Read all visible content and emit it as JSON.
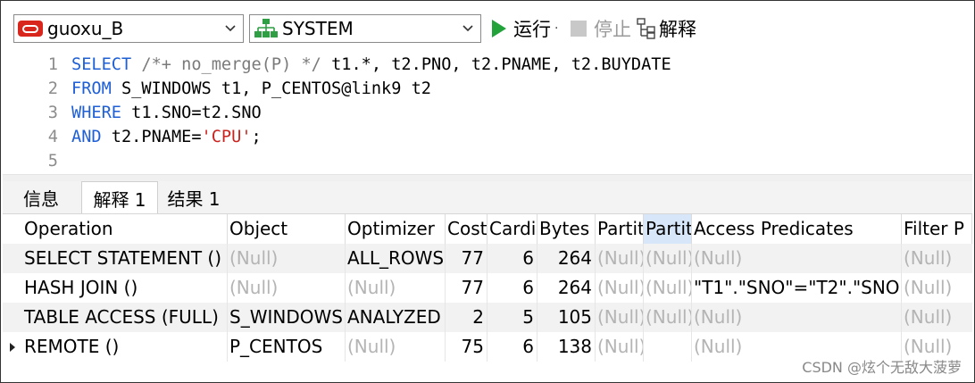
{
  "toolbar": {
    "connection": "guoxu_B",
    "schema": "SYSTEM",
    "run_label": "运行",
    "run_dropdown": "·",
    "stop_label": "停止",
    "explain_label": "解释"
  },
  "editor": {
    "lines": [
      {
        "num": "1",
        "parts": [
          {
            "t": "SELECT",
            "c": "kw"
          },
          {
            "t": " ",
            "c": ""
          },
          {
            "t": "/*+ no_merge(P) */",
            "c": "cm"
          },
          {
            "t": " t1.*, t2.PNO, t2.PNAME, t2.BUYDATE",
            "c": ""
          }
        ]
      },
      {
        "num": "2",
        "parts": [
          {
            "t": "FROM",
            "c": "kw"
          },
          {
            "t": " S_WINDOWS t1, P_CENTOS@link9 t2",
            "c": ""
          }
        ]
      },
      {
        "num": "3",
        "parts": [
          {
            "t": "WHERE",
            "c": "kw"
          },
          {
            "t": " t1.SNO=t2.SNO",
            "c": ""
          }
        ]
      },
      {
        "num": "4",
        "parts": [
          {
            "t": "AND",
            "c": "kw"
          },
          {
            "t": " t2.PNAME=",
            "c": ""
          },
          {
            "t": "'CPU'",
            "c": "str"
          },
          {
            "t": ";",
            "c": ""
          }
        ]
      },
      {
        "num": "5",
        "parts": []
      }
    ]
  },
  "tabs": [
    {
      "label": "信息",
      "active": false
    },
    {
      "label": "解释 1",
      "active": true
    },
    {
      "label": "结果 1",
      "active": false
    }
  ],
  "grid": {
    "columns": [
      "Operation",
      "Object",
      "Optimizer",
      "Cost",
      "Cardi",
      "Bytes",
      "Partit",
      "Partit",
      "Access Predicates",
      "Filter P"
    ],
    "rows": [
      {
        "cells": [
          "SELECT STATEMENT ()",
          "(Null)",
          "ALL_ROWS",
          "77",
          "6",
          "264",
          "(Null)",
          "(Null)",
          "(Null)",
          "(Null)"
        ],
        "current": false
      },
      {
        "cells": [
          " HASH JOIN ()",
          "(Null)",
          "(Null)",
          "77",
          "6",
          "264",
          "(Null)",
          "(Null)",
          "\"T1\".\"SNO\"=\"T2\".\"SNO\"",
          "(Null)"
        ],
        "current": false
      },
      {
        "cells": [
          "  TABLE ACCESS (FULL)",
          "S_WINDOWS",
          "ANALYZED",
          "2",
          "5",
          "105",
          "(Null)",
          "(Null)",
          "(Null)",
          "(Null)"
        ],
        "current": false
      },
      {
        "cells": [
          "  REMOTE ()",
          "P_CENTOS",
          "(Null)",
          "75",
          "6",
          "138",
          "(Null)",
          "",
          "(Null)",
          "(Null)"
        ],
        "current": true
      }
    ]
  },
  "watermark": "CSDN @炫个无敌大菠萝",
  "colors": {
    "keyword": "#1e5fd6",
    "comment": "#7a7a7a",
    "string": "#c8231e",
    "null_text": "#b4b4b4",
    "run": "#22a33a"
  }
}
